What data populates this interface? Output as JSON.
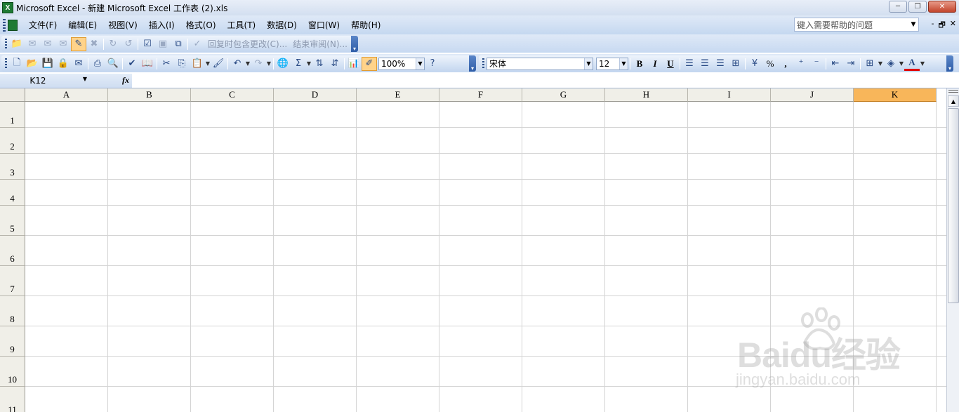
{
  "window": {
    "title": "Microsoft Excel - 新建 Microsoft Excel 工作表 (2).xls",
    "app_icon_glyph": "X",
    "controls": [
      "─",
      "❐",
      "✕"
    ]
  },
  "menubar": {
    "items": [
      "文件(F)",
      "编辑(E)",
      "视图(V)",
      "插入(I)",
      "格式(O)",
      "工具(T)",
      "数据(D)",
      "窗口(W)",
      "帮助(H)"
    ],
    "help_placeholder": "键入需要帮助的问题",
    "mdi_controls": [
      "-",
      "🗗",
      "✕"
    ]
  },
  "review_toolbar": {
    "reply_label": "回复时包含更改(C)...",
    "end_review_label": "结束审阅(N)..."
  },
  "standard_toolbar": {
    "zoom": "100%"
  },
  "format_toolbar": {
    "font_name": "宋体",
    "font_size": "12",
    "bold": "B",
    "italic": "I",
    "underline": "U",
    "percent": "%",
    "comma": ","
  },
  "formula_bar": {
    "name_box": "K12",
    "fx": "fx",
    "formula": ""
  },
  "sheet": {
    "columns": [
      "A",
      "B",
      "C",
      "D",
      "E",
      "F",
      "G",
      "H",
      "I",
      "J",
      "K"
    ],
    "selected_column": "K",
    "rows": [
      "1",
      "2",
      "3",
      "4",
      "5",
      "6",
      "7",
      "8",
      "9",
      "10",
      "11"
    ]
  },
  "watermark": {
    "brand": "Baidu经验",
    "url": "jingyan.baidu.com"
  },
  "colors": {
    "selected_header": "#f8b65a",
    "toolbar_end": "#2f5ea8",
    "grid_line": "#d4d4d4"
  }
}
